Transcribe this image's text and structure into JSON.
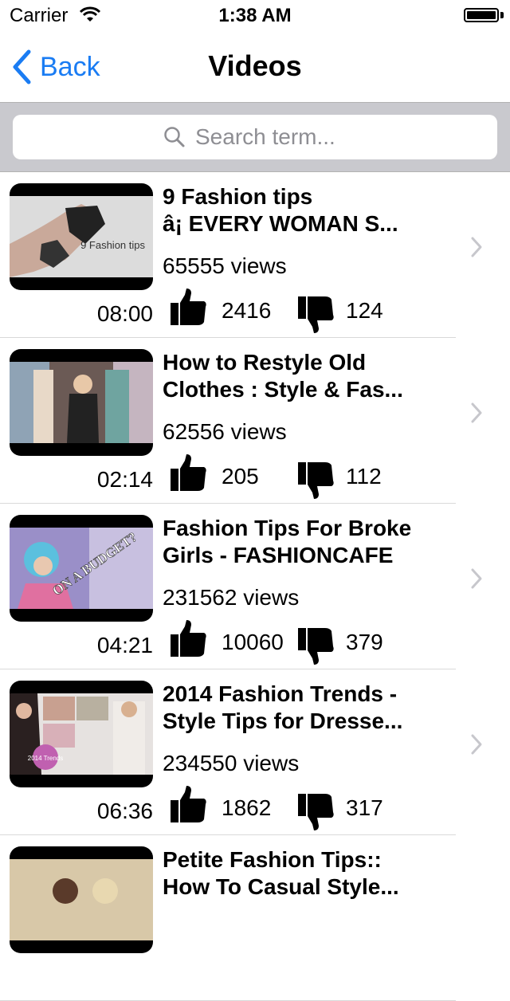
{
  "status": {
    "carrier": "Carrier",
    "time": "1:38 AM"
  },
  "nav": {
    "back_label": "Back",
    "title": "Videos"
  },
  "search": {
    "placeholder": "Search term..."
  },
  "videos": [
    {
      "title_line1": "9 Fashion tips",
      "title_line2": "â¡ EVERY WOMAN S...",
      "views": "65555 views",
      "duration": "08:00",
      "likes": "2416",
      "dislikes": "124",
      "thumb_text": "9 Fashion tips"
    },
    {
      "title_line1": "How to Restyle Old",
      "title_line2": "Clothes : Style & Fas...",
      "views": "62556 views",
      "duration": "02:14",
      "likes": "205",
      "dislikes": "112"
    },
    {
      "title_line1": "Fashion Tips For Broke",
      "title_line2": "Girls - FASHIONCAFE",
      "views": "231562 views",
      "duration": "04:21",
      "likes": "10060",
      "dislikes": "379",
      "thumb_text": "ON A BUDGET?"
    },
    {
      "title_line1": "2014 Fashion Trends -",
      "title_line2": "Style Tips for Dresse...",
      "views": "234550 views",
      "duration": "06:36",
      "likes": "1862",
      "dislikes": "317",
      "thumb_text": "2014 Trends"
    },
    {
      "title_line1": "Petite Fashion Tips::",
      "title_line2": "How To Casual Style..."
    }
  ]
}
